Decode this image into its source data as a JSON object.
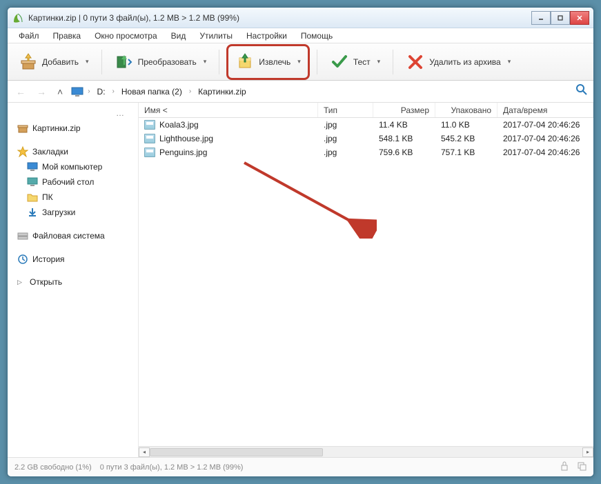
{
  "titlebar": {
    "title": "Картинки.zip | 0 пути 3 файл(ы), 1.2 MB > 1.2 MB (99%)"
  },
  "menu": {
    "items": [
      "Файл",
      "Правка",
      "Окно просмотра",
      "Вид",
      "Утилиты",
      "Настройки",
      "Помощь"
    ]
  },
  "toolbar": {
    "add": "Добавить",
    "convert": "Преобразовать",
    "extract": "Извлечь",
    "test": "Тест",
    "delete": "Удалить из архива"
  },
  "breadcrumb": {
    "drive": "D:",
    "folder": "Новая папка (2)",
    "archive": "Картинки.zip"
  },
  "sidebar": {
    "archive": "Картинки.zip",
    "bookmarks": "Закладки",
    "mycomputer": "Мой компьютер",
    "desktop": "Рабочий стол",
    "pc": "ПК",
    "downloads": "Загрузки",
    "filesystem": "Файловая система",
    "history": "История",
    "open": "Открыть"
  },
  "columns": {
    "name": "Имя <",
    "type": "Тип",
    "size": "Размер",
    "packed": "Упаковано",
    "date": "Дата/время"
  },
  "files": [
    {
      "name": "Koala3.jpg",
      "type": ".jpg",
      "size": "11.4 KB",
      "packed": "11.0 KB",
      "date": "2017-07-04 20:46:26"
    },
    {
      "name": "Lighthouse.jpg",
      "type": ".jpg",
      "size": "548.1 KB",
      "packed": "545.2 KB",
      "date": "2017-07-04 20:46:26"
    },
    {
      "name": "Penguins.jpg",
      "type": ".jpg",
      "size": "759.6 KB",
      "packed": "757.1 KB",
      "date": "2017-07-04 20:46:26"
    }
  ],
  "statusbar": {
    "free": "2.2 GB свободно (1%)",
    "selection": "0 пути 3 файл(ы), 1.2 MB > 1.2 MB (99%)"
  }
}
